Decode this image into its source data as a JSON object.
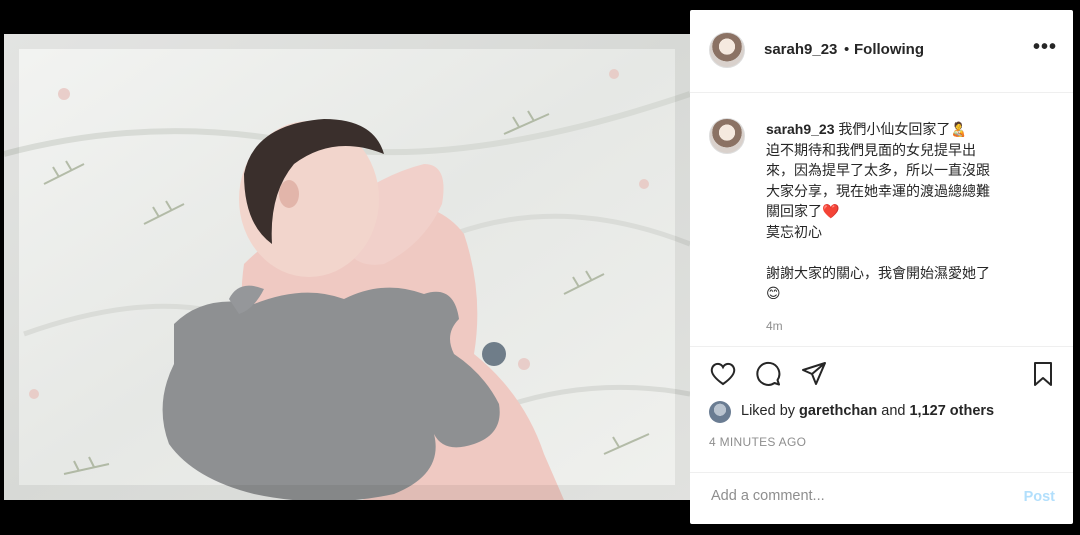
{
  "post": {
    "username": "sarah9_23",
    "separator": "•",
    "follow_status": "Following",
    "more_icon": "more-horizontal-icon",
    "caption_username": "sarah9_23",
    "caption_lines": [
      "我們小仙女回家了🧑‍🍼",
      "迫不期待和我們見面的女兒提早出",
      "來，因為提早了太多，所以一直沒跟",
      "大家分享，現在她幸運的渡過總總難",
      "關回家了❤️",
      "莫忘初心",
      "",
      "謝謝大家的關心，我會開始濕愛她了",
      "😊"
    ],
    "caption_time": "4m",
    "likes_prefix": "Liked by",
    "likes_user": "garethchan",
    "likes_mid": "and",
    "likes_count": "1,127 others",
    "time_ago": "4 MINUTES AGO",
    "comment_placeholder": "Add a comment...",
    "post_button": "Post"
  },
  "colors": {
    "text": "#262626",
    "muted": "#8e8e8e",
    "post_disabled": "#b2dffc"
  }
}
